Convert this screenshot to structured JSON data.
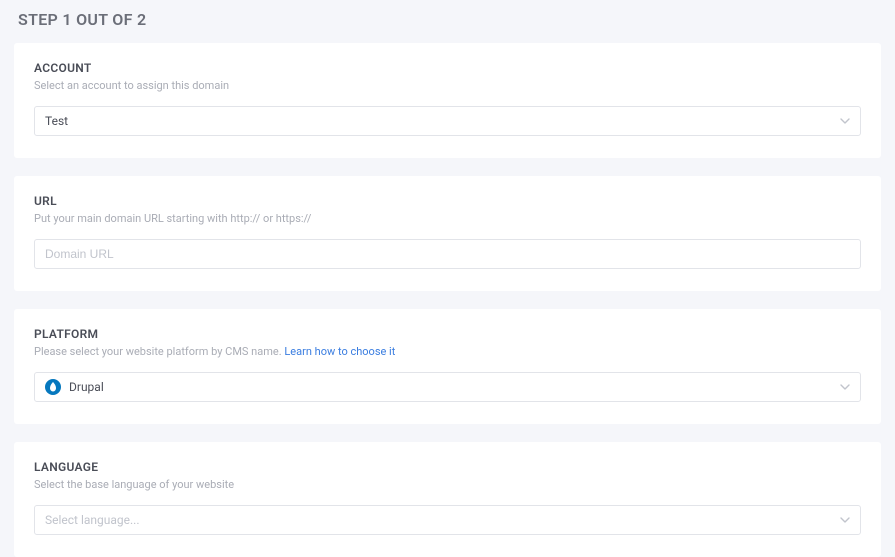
{
  "header": {
    "step_text": "STEP 1 OUT OF 2"
  },
  "account": {
    "title": "ACCOUNT",
    "subtitle": "Select an account to assign this domain",
    "selected": "Test"
  },
  "url": {
    "title": "URL",
    "subtitle": "Put your main domain URL starting with http:// or https://",
    "placeholder": "Domain URL",
    "value": ""
  },
  "platform": {
    "title": "PLATFORM",
    "subtitle_prefix": "Please select your website platform by CMS name. ",
    "link_text": "Learn how to choose it",
    "selected": "Drupal",
    "icon_color": "#0678be"
  },
  "language": {
    "title": "LANGUAGE",
    "subtitle": "Select the base language of your website",
    "placeholder": "Select language..."
  }
}
